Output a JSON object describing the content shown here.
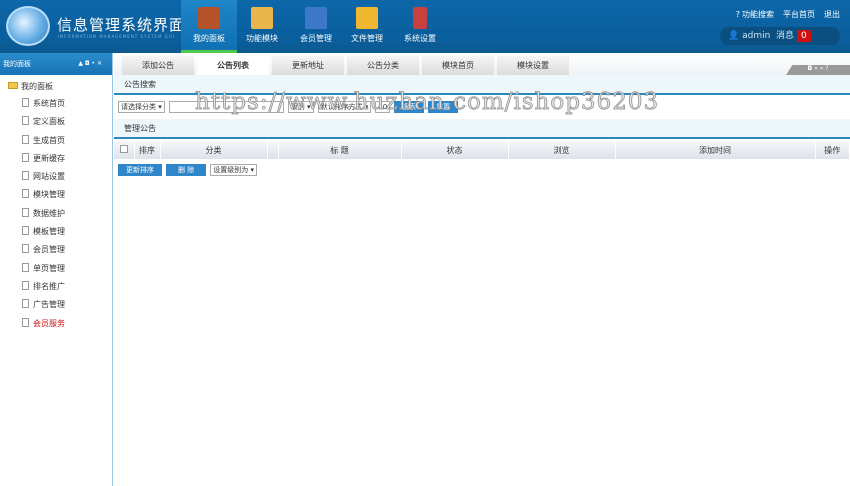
{
  "header": {
    "title": "信息管理系统界面",
    "subtitle": "INFORMATION MANAGEMENT SYSTEM GUI",
    "nav": [
      {
        "label": "我的面板",
        "color": "#b5522a"
      },
      {
        "label": "功能模块",
        "color": "#e8b64a"
      },
      {
        "label": "会员管理",
        "color": "#3d79c8"
      },
      {
        "label": "文件管理",
        "color": "#f0b830"
      },
      {
        "label": "系统设置",
        "color": "#c84040"
      }
    ],
    "links": [
      "功能搜索",
      "平台首页",
      "退出"
    ],
    "user": "admin",
    "msg_label": "消息",
    "msg_count": "0"
  },
  "sidebar": {
    "title": "我的面板",
    "controls": "▲ ◘ • ✕",
    "root": "我的面板",
    "items": [
      "系统首页",
      "定义面板",
      "生成首页",
      "更新缓存",
      "网站设置",
      "模块管理",
      "数据维护",
      "模板管理",
      "会员管理",
      "单页管理",
      "排名推广",
      "广告管理",
      "会员服务"
    ]
  },
  "tabs": [
    "添加公告",
    "公告列表",
    "更新地址",
    "公告分类",
    "模块首页",
    "模块设置"
  ],
  "tabnav": "◘ « » ?",
  "search": {
    "title": "公告搜索",
    "category": "请选择分类 ▾",
    "level": "级别 ▾",
    "order": "默认排序方式 ▾",
    "page_size": "20",
    "search_btn": "搜索",
    "reset_btn": "重置"
  },
  "manage": {
    "title": "管理公告",
    "columns": [
      "排序",
      "分类",
      "",
      "标 题",
      "状态",
      "浏览",
      "添加时间",
      "操作"
    ],
    "update_btn": "更新排序",
    "delete_btn": "删 除",
    "level_select": "设置级别为 ▾"
  },
  "watermark": "https://www.huzhan.com/ishop36203"
}
